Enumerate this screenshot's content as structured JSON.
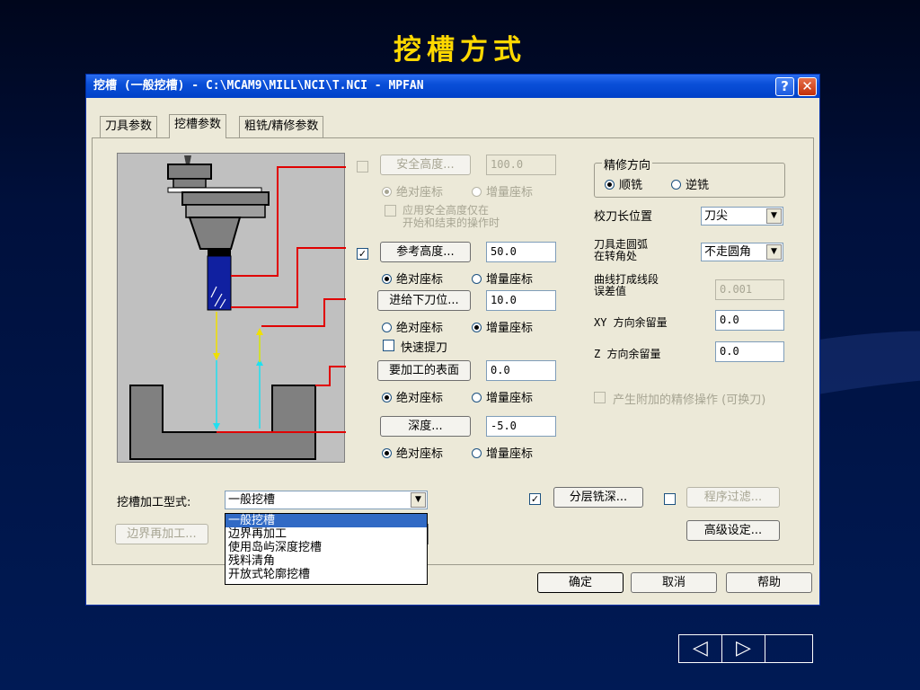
{
  "slide": {
    "title": "挖槽方式"
  },
  "dialog": {
    "title": "挖槽 (一般挖槽) - C:\\MCAM9\\MILL\\NCI\\T.NCI - MPFAN",
    "help_button": "?",
    "close_button": "✕",
    "tabs": [
      {
        "label": "刀具参数"
      },
      {
        "label": "挖槽参数"
      },
      {
        "label": "粗铣/精修参数"
      }
    ]
  },
  "params": {
    "safe_height": {
      "label": "安全高度...",
      "value": "100.0",
      "checked": false
    },
    "safe_abs": "绝对座标",
    "safe_inc": "增量座标",
    "safe_option_line1": "应用安全高度仅在",
    "safe_option_line2": "开始和结束的操作时",
    "ref_height": {
      "label": "参考高度...",
      "value": "50.0",
      "checked": true
    },
    "ref_abs": "绝对座标",
    "ref_inc": "增量座标",
    "feed_plane": {
      "label": "进给下刀位...",
      "value": "10.0"
    },
    "feed_abs": "绝对座标",
    "feed_inc": "增量座标",
    "rapid_retract": "快速提刀",
    "top_stock": {
      "label": "要加工的表面",
      "value": "0.0"
    },
    "top_abs": "绝对座标",
    "top_inc": "增量座标",
    "depth": {
      "label": "深度...",
      "value": "-5.0"
    },
    "depth_abs": "绝对座标",
    "depth_inc": "增量座标"
  },
  "finish": {
    "direction_legend": "精修方向",
    "climb": "顺铣",
    "conventional": "逆铣",
    "compensation_label": "校刀长位置",
    "compensation_value": "刀尖",
    "corner_label_line1": "刀具走圆弧",
    "corner_label_line2": "在转角处",
    "corner_value": "不走圆角",
    "tolerance_label_line1": "曲线打成线段",
    "tolerance_label_line2": "误差值",
    "tolerance_value": "0.001",
    "xy_stock_label": "XY 方向余留量",
    "xy_stock_value": "0.0",
    "z_stock_label": "Z 方向余留量",
    "z_stock_value": "0.0",
    "extra_finish": "产生附加的精修操作 (可换刀)"
  },
  "bottom": {
    "pocket_type_label": "挖槽加工型式:",
    "pocket_type_value": "一般挖槽",
    "pocket_type_options": [
      "一般挖槽",
      "边界再加工",
      "使用岛屿深度挖槽",
      "残料清角",
      "开放式轮廓挖槽"
    ],
    "remachine_button": "边界再加工...",
    "depth_cuts_button": "分层铣深...",
    "depth_cuts_checked": true,
    "filter_button": "程序过滤...",
    "filter_checked": false,
    "advanced_button": "高级设定...",
    "ok": "确定",
    "cancel": "取消",
    "help": "帮助"
  },
  "nav": {
    "prev": "◁",
    "next": "▷"
  },
  "colors": {
    "slide_title": "#ffd800",
    "diagram_line": "#e00000",
    "feed_arrow": "#f0e000",
    "rapid_arrow": "#20e0f0",
    "tool_blue": "#1020a0"
  }
}
